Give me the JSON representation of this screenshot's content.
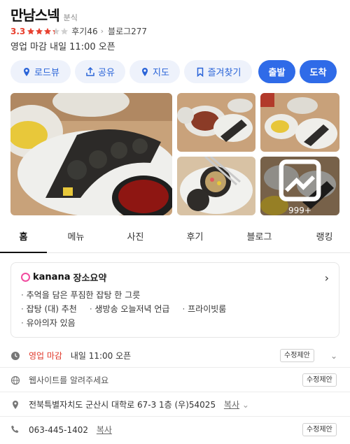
{
  "place": {
    "name": "만남스넥",
    "category": "분식"
  },
  "rating": {
    "score": "3.3",
    "reviews": "후기46",
    "blog": "블로그277",
    "stars_filled": 3.3,
    "stars_total": 5
  },
  "hours_line": "영업 마감  내일 11:00 오픈",
  "actions": {
    "roadview": "로드뷰",
    "share": "공유",
    "map": "지도",
    "save": "즐겨찾기",
    "depart": "출발",
    "arrive": "도착"
  },
  "photos": {
    "more_count": "999+"
  },
  "tabs": [
    "홈",
    "메뉴",
    "사진",
    "후기",
    "블로그",
    "랭킹"
  ],
  "summary": {
    "brand": "kanana",
    "title": "장소요약",
    "lines": [
      [
        "추억을 담은 푸짐한 잡탕 한 그릇"
      ],
      [
        "잡탕 (대) 추천",
        "생방송 오늘저녁 언급",
        "프라이빗룸"
      ],
      [
        "유아의자 있음"
      ]
    ]
  },
  "info": {
    "status": "영업 마감",
    "next_open": "내일 11:00 오픈",
    "website_prompt": "웹사이트를 알려주세요",
    "address": "전북특별자치도 군산시 대학로 67-3 1층 (우)54025",
    "phone": "063-445-1402",
    "copy_label": "복사",
    "edit_label": "수정제안"
  },
  "colors": {
    "accent": "#2f6be8",
    "star": "#e8402f",
    "closed": "#e0392b",
    "kanana": "#f14b9f"
  }
}
